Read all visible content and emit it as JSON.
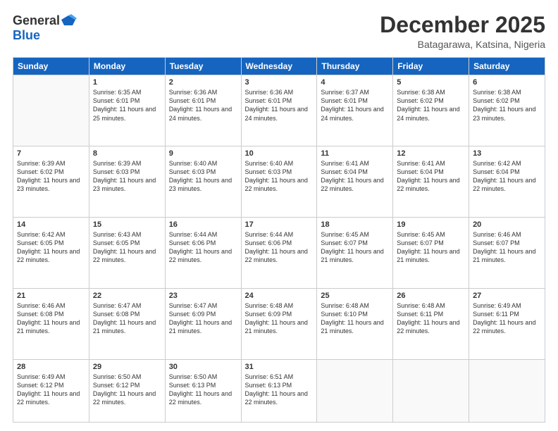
{
  "logo": {
    "general": "General",
    "blue": "Blue"
  },
  "header": {
    "month": "December 2025",
    "location": "Batagarawa, Katsina, Nigeria"
  },
  "weekdays": [
    "Sunday",
    "Monday",
    "Tuesday",
    "Wednesday",
    "Thursday",
    "Friday",
    "Saturday"
  ],
  "weeks": [
    [
      {
        "day": "",
        "sunrise": "",
        "sunset": "",
        "daylight": ""
      },
      {
        "day": "1",
        "sunrise": "Sunrise: 6:35 AM",
        "sunset": "Sunset: 6:01 PM",
        "daylight": "Daylight: 11 hours and 25 minutes."
      },
      {
        "day": "2",
        "sunrise": "Sunrise: 6:36 AM",
        "sunset": "Sunset: 6:01 PM",
        "daylight": "Daylight: 11 hours and 24 minutes."
      },
      {
        "day": "3",
        "sunrise": "Sunrise: 6:36 AM",
        "sunset": "Sunset: 6:01 PM",
        "daylight": "Daylight: 11 hours and 24 minutes."
      },
      {
        "day": "4",
        "sunrise": "Sunrise: 6:37 AM",
        "sunset": "Sunset: 6:01 PM",
        "daylight": "Daylight: 11 hours and 24 minutes."
      },
      {
        "day": "5",
        "sunrise": "Sunrise: 6:38 AM",
        "sunset": "Sunset: 6:02 PM",
        "daylight": "Daylight: 11 hours and 24 minutes."
      },
      {
        "day": "6",
        "sunrise": "Sunrise: 6:38 AM",
        "sunset": "Sunset: 6:02 PM",
        "daylight": "Daylight: 11 hours and 23 minutes."
      }
    ],
    [
      {
        "day": "7",
        "sunrise": "Sunrise: 6:39 AM",
        "sunset": "Sunset: 6:02 PM",
        "daylight": "Daylight: 11 hours and 23 minutes."
      },
      {
        "day": "8",
        "sunrise": "Sunrise: 6:39 AM",
        "sunset": "Sunset: 6:03 PM",
        "daylight": "Daylight: 11 hours and 23 minutes."
      },
      {
        "day": "9",
        "sunrise": "Sunrise: 6:40 AM",
        "sunset": "Sunset: 6:03 PM",
        "daylight": "Daylight: 11 hours and 23 minutes."
      },
      {
        "day": "10",
        "sunrise": "Sunrise: 6:40 AM",
        "sunset": "Sunset: 6:03 PM",
        "daylight": "Daylight: 11 hours and 22 minutes."
      },
      {
        "day": "11",
        "sunrise": "Sunrise: 6:41 AM",
        "sunset": "Sunset: 6:04 PM",
        "daylight": "Daylight: 11 hours and 22 minutes."
      },
      {
        "day": "12",
        "sunrise": "Sunrise: 6:41 AM",
        "sunset": "Sunset: 6:04 PM",
        "daylight": "Daylight: 11 hours and 22 minutes."
      },
      {
        "day": "13",
        "sunrise": "Sunrise: 6:42 AM",
        "sunset": "Sunset: 6:04 PM",
        "daylight": "Daylight: 11 hours and 22 minutes."
      }
    ],
    [
      {
        "day": "14",
        "sunrise": "Sunrise: 6:42 AM",
        "sunset": "Sunset: 6:05 PM",
        "daylight": "Daylight: 11 hours and 22 minutes."
      },
      {
        "day": "15",
        "sunrise": "Sunrise: 6:43 AM",
        "sunset": "Sunset: 6:05 PM",
        "daylight": "Daylight: 11 hours and 22 minutes."
      },
      {
        "day": "16",
        "sunrise": "Sunrise: 6:44 AM",
        "sunset": "Sunset: 6:06 PM",
        "daylight": "Daylight: 11 hours and 22 minutes."
      },
      {
        "day": "17",
        "sunrise": "Sunrise: 6:44 AM",
        "sunset": "Sunset: 6:06 PM",
        "daylight": "Daylight: 11 hours and 22 minutes."
      },
      {
        "day": "18",
        "sunrise": "Sunrise: 6:45 AM",
        "sunset": "Sunset: 6:07 PM",
        "daylight": "Daylight: 11 hours and 21 minutes."
      },
      {
        "day": "19",
        "sunrise": "Sunrise: 6:45 AM",
        "sunset": "Sunset: 6:07 PM",
        "daylight": "Daylight: 11 hours and 21 minutes."
      },
      {
        "day": "20",
        "sunrise": "Sunrise: 6:46 AM",
        "sunset": "Sunset: 6:07 PM",
        "daylight": "Daylight: 11 hours and 21 minutes."
      }
    ],
    [
      {
        "day": "21",
        "sunrise": "Sunrise: 6:46 AM",
        "sunset": "Sunset: 6:08 PM",
        "daylight": "Daylight: 11 hours and 21 minutes."
      },
      {
        "day": "22",
        "sunrise": "Sunrise: 6:47 AM",
        "sunset": "Sunset: 6:08 PM",
        "daylight": "Daylight: 11 hours and 21 minutes."
      },
      {
        "day": "23",
        "sunrise": "Sunrise: 6:47 AM",
        "sunset": "Sunset: 6:09 PM",
        "daylight": "Daylight: 11 hours and 21 minutes."
      },
      {
        "day": "24",
        "sunrise": "Sunrise: 6:48 AM",
        "sunset": "Sunset: 6:09 PM",
        "daylight": "Daylight: 11 hours and 21 minutes."
      },
      {
        "day": "25",
        "sunrise": "Sunrise: 6:48 AM",
        "sunset": "Sunset: 6:10 PM",
        "daylight": "Daylight: 11 hours and 21 minutes."
      },
      {
        "day": "26",
        "sunrise": "Sunrise: 6:48 AM",
        "sunset": "Sunset: 6:11 PM",
        "daylight": "Daylight: 11 hours and 22 minutes."
      },
      {
        "day": "27",
        "sunrise": "Sunrise: 6:49 AM",
        "sunset": "Sunset: 6:11 PM",
        "daylight": "Daylight: 11 hours and 22 minutes."
      }
    ],
    [
      {
        "day": "28",
        "sunrise": "Sunrise: 6:49 AM",
        "sunset": "Sunset: 6:12 PM",
        "daylight": "Daylight: 11 hours and 22 minutes."
      },
      {
        "day": "29",
        "sunrise": "Sunrise: 6:50 AM",
        "sunset": "Sunset: 6:12 PM",
        "daylight": "Daylight: 11 hours and 22 minutes."
      },
      {
        "day": "30",
        "sunrise": "Sunrise: 6:50 AM",
        "sunset": "Sunset: 6:13 PM",
        "daylight": "Daylight: 11 hours and 22 minutes."
      },
      {
        "day": "31",
        "sunrise": "Sunrise: 6:51 AM",
        "sunset": "Sunset: 6:13 PM",
        "daylight": "Daylight: 11 hours and 22 minutes."
      },
      {
        "day": "",
        "sunrise": "",
        "sunset": "",
        "daylight": ""
      },
      {
        "day": "",
        "sunrise": "",
        "sunset": "",
        "daylight": ""
      },
      {
        "day": "",
        "sunrise": "",
        "sunset": "",
        "daylight": ""
      }
    ]
  ]
}
